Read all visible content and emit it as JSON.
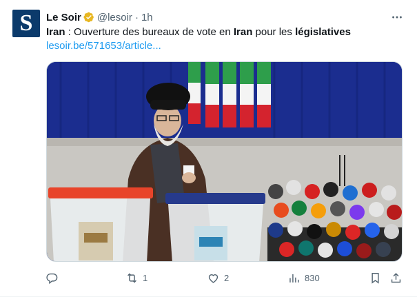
{
  "tweet": {
    "avatar_letter": "S",
    "author": "Le Soir",
    "handle": "@lesoir",
    "separator": "·",
    "time": "1h",
    "text_parts": {
      "p1": "Iran",
      "p2": " : Ouverture des bureaux de vote en ",
      "p3": "Iran",
      "p4": " pour les ",
      "p5": "législatives"
    },
    "link": "lesoir.be/571653/article..."
  },
  "actions": {
    "reply_count": "",
    "retweet_count": "1",
    "like_count": "2",
    "views_count": "830"
  },
  "colors": {
    "link": "#1d9bf0",
    "verified_badge": "#e8b722",
    "muted": "#536471",
    "avatar_bg": "#0b3a6b"
  },
  "icons": [
    "more-icon",
    "verified-icon",
    "reply-icon",
    "retweet-icon",
    "like-icon",
    "views-icon",
    "bookmark-icon",
    "share-icon"
  ]
}
